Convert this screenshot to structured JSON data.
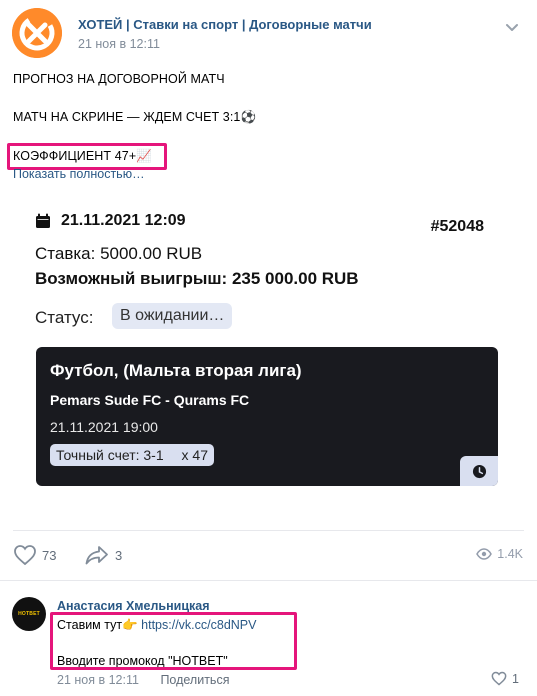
{
  "post": {
    "author": "ХОТЕЙ | Ставки на спорт | Договорные матчи",
    "date": "21 ноя в 12:11",
    "lines": [
      "ПРОГНОЗ НА ДОГОВОРНОЙ МАТЧ",
      "МАТЧ НА СКРИНЕ — ЖДЕМ СЧЕТ 3:1⚽",
      "КОЭФФИЦИЕНТ 47+📈"
    ],
    "show_more": "Показать полностью…"
  },
  "bet": {
    "date": "21.11.2021 12:09",
    "id": "#52048",
    "stake": "Ставка: 5000.00 RUB",
    "win": "Возможный выигрыш: 235 000.00 RUB",
    "status_label": "Статус:",
    "status_value": "В ожидании…",
    "sport": "Футбол, (Мальта вторая лига)",
    "teams": "Pemars Sude FC - Qurams FC",
    "match_time": "21.11.2021 19:00",
    "score_text": "Точный счет: 3-1",
    "odds": "x 47"
  },
  "actions": {
    "likes": "73",
    "shares": "3",
    "views": "1.4K"
  },
  "comment": {
    "author": "Анастасия Хмельницкая",
    "avatar_text": "HOTBET",
    "line1_text": "Ставим тут👉",
    "line1_link": "https://vk.cc/c8dNPV",
    "line2": "Вводите промокод \"HOTBET\"",
    "date": "21 ноя в 12:11",
    "share": "Поделиться",
    "likes": "1"
  },
  "colors": {
    "link": "#2a5885",
    "highlight": "#e5157b",
    "card_bg": "#191a1f",
    "pill_bg": "#d9dff0"
  }
}
